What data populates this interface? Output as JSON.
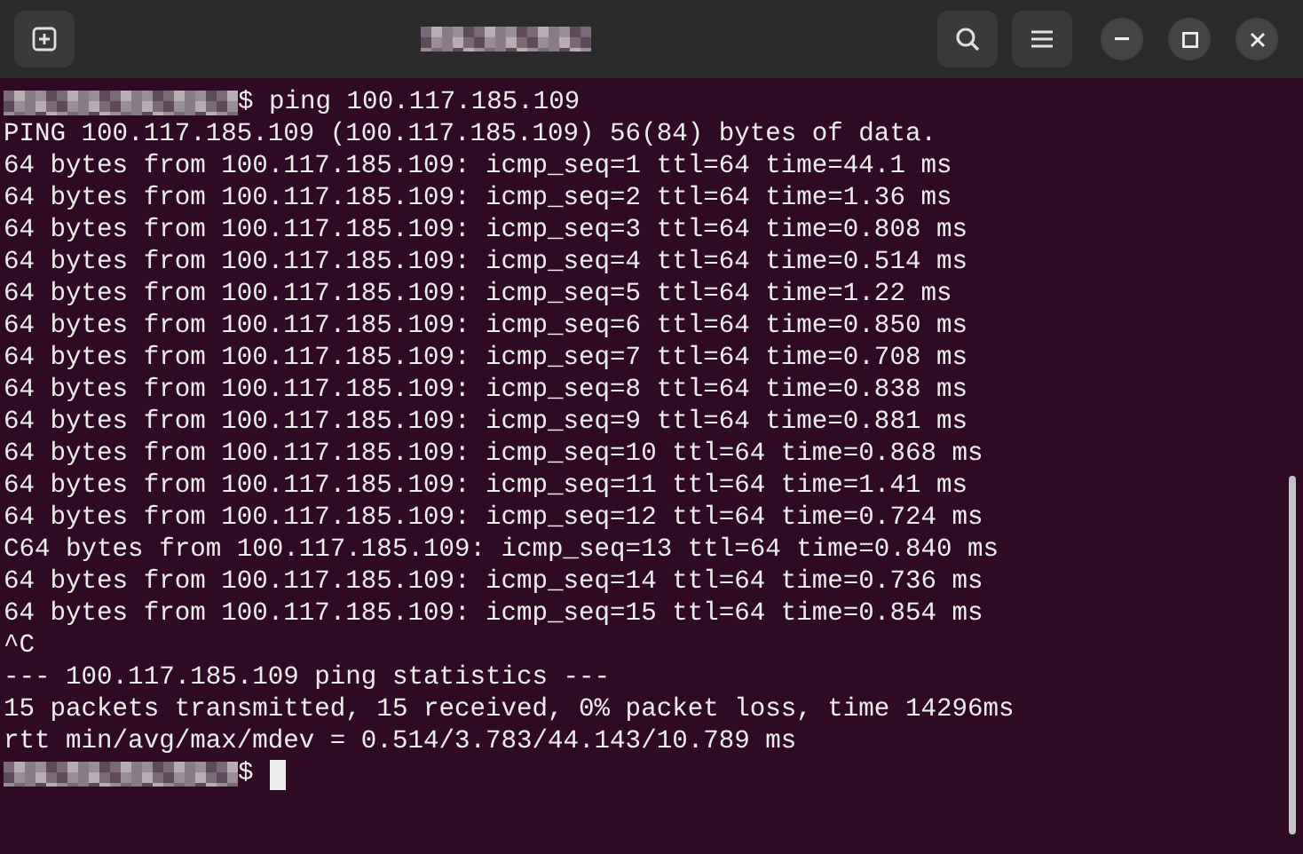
{
  "lines": [
    {
      "kind": "prompt",
      "text": "$ ping 100.117.185.109",
      "cursor": false
    },
    {
      "kind": "output",
      "text": "PING 100.117.185.109 (100.117.185.109) 56(84) bytes of data."
    },
    {
      "kind": "output",
      "text": "64 bytes from 100.117.185.109: icmp_seq=1 ttl=64 time=44.1 ms"
    },
    {
      "kind": "output",
      "text": "64 bytes from 100.117.185.109: icmp_seq=2 ttl=64 time=1.36 ms"
    },
    {
      "kind": "output",
      "text": "64 bytes from 100.117.185.109: icmp_seq=3 ttl=64 time=0.808 ms"
    },
    {
      "kind": "output",
      "text": "64 bytes from 100.117.185.109: icmp_seq=4 ttl=64 time=0.514 ms"
    },
    {
      "kind": "output",
      "text": "64 bytes from 100.117.185.109: icmp_seq=5 ttl=64 time=1.22 ms"
    },
    {
      "kind": "output",
      "text": "64 bytes from 100.117.185.109: icmp_seq=6 ttl=64 time=0.850 ms"
    },
    {
      "kind": "output",
      "text": "64 bytes from 100.117.185.109: icmp_seq=7 ttl=64 time=0.708 ms"
    },
    {
      "kind": "output",
      "text": "64 bytes from 100.117.185.109: icmp_seq=8 ttl=64 time=0.838 ms"
    },
    {
      "kind": "output",
      "text": "64 bytes from 100.117.185.109: icmp_seq=9 ttl=64 time=0.881 ms"
    },
    {
      "kind": "output",
      "text": "64 bytes from 100.117.185.109: icmp_seq=10 ttl=64 time=0.868 ms"
    },
    {
      "kind": "output",
      "text": "64 bytes from 100.117.185.109: icmp_seq=11 ttl=64 time=1.41 ms"
    },
    {
      "kind": "output",
      "text": "64 bytes from 100.117.185.109: icmp_seq=12 ttl=64 time=0.724 ms"
    },
    {
      "kind": "output",
      "text": "C64 bytes from 100.117.185.109: icmp_seq=13 ttl=64 time=0.840 ms"
    },
    {
      "kind": "output",
      "text": "64 bytes from 100.117.185.109: icmp_seq=14 ttl=64 time=0.736 ms"
    },
    {
      "kind": "output",
      "text": "64 bytes from 100.117.185.109: icmp_seq=15 ttl=64 time=0.854 ms"
    },
    {
      "kind": "output",
      "text": "^C"
    },
    {
      "kind": "output",
      "text": "--- 100.117.185.109 ping statistics ---"
    },
    {
      "kind": "output",
      "text": "15 packets transmitted, 15 received, 0% packet loss, time 14296ms"
    },
    {
      "kind": "output",
      "text": "rtt min/avg/max/mdev = 0.514/3.783/44.143/10.789 ms"
    },
    {
      "kind": "prompt",
      "text": "$",
      "cursor": true
    }
  ]
}
